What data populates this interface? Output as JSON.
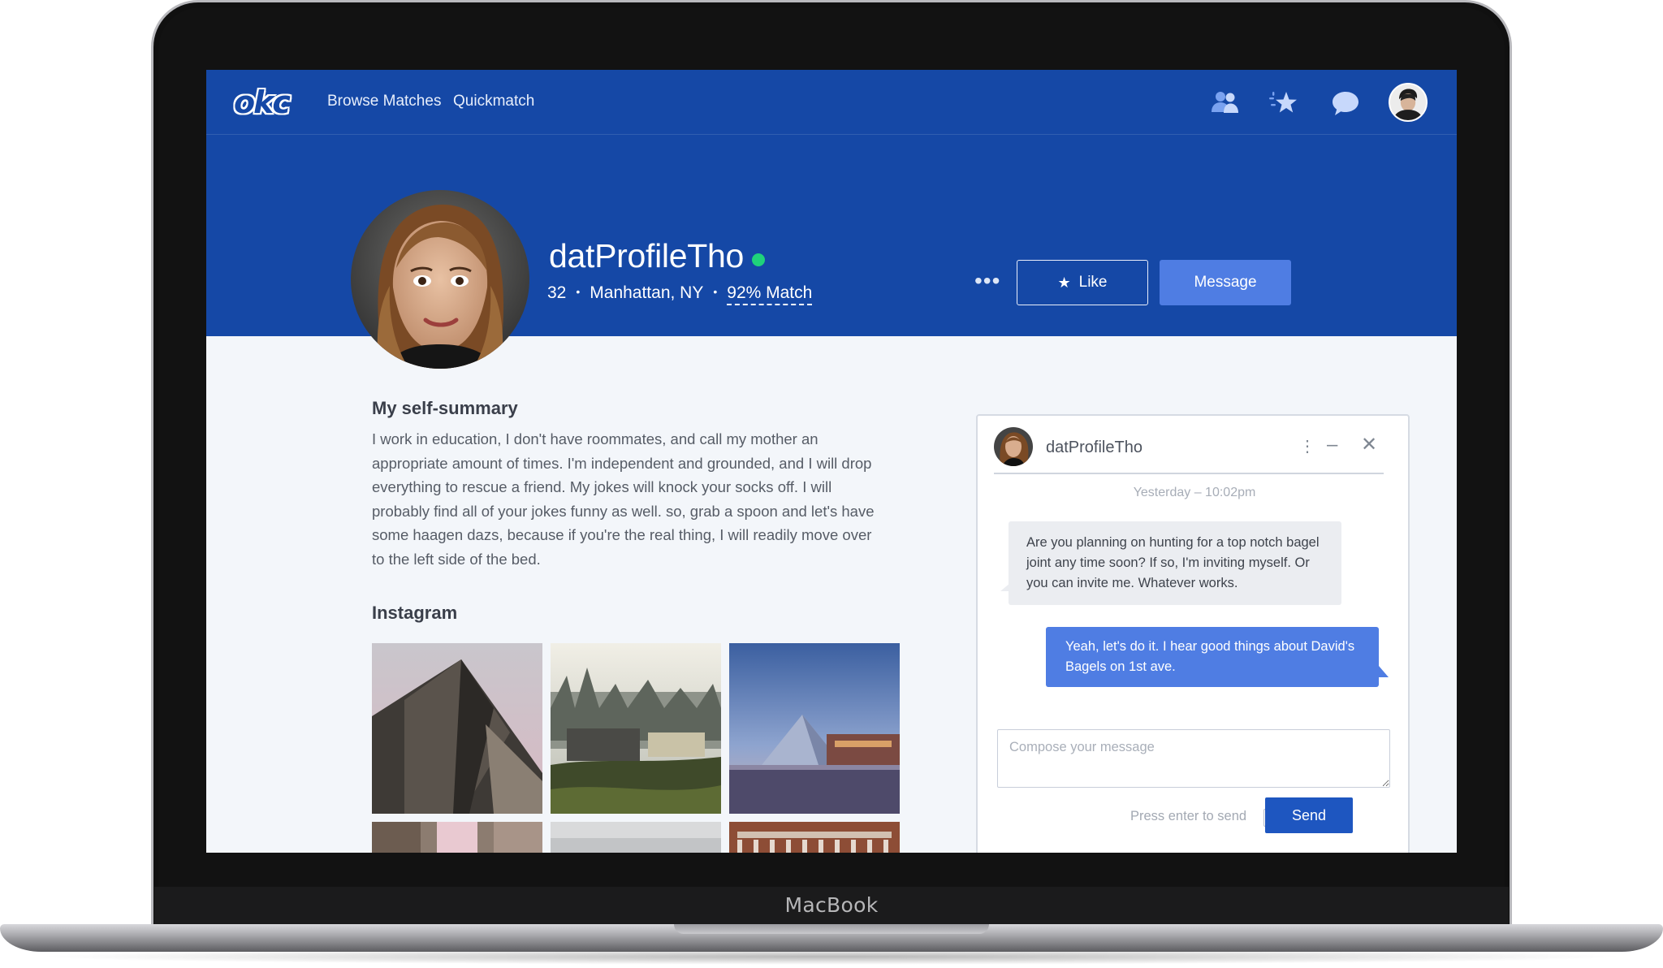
{
  "device": {
    "brand": "MacBook"
  },
  "nav": {
    "logo": "okc",
    "links": [
      "Browse Matches",
      "Quickmatch"
    ],
    "icons": [
      "people-icon",
      "stars-icon",
      "chat-bubble-icon"
    ],
    "colors": {
      "primary": "#1548a6",
      "accent": "#4f7de3",
      "online": "#1fd27b"
    }
  },
  "profile": {
    "username": "datProfileTho",
    "age": "32",
    "location": "Manhattan, NY",
    "match": "92% Match",
    "like_label": "Like",
    "message_label": "Message",
    "more_label": "•••"
  },
  "summary": {
    "title": "My self-summary",
    "text": "I work in education, I don't have roommates, and call my mother an appropriate amount of times. I'm independent and grounded, and I will drop everything to rescue a friend. My jokes will knock your socks off. I will probably find all of your jokes funny as well. so, grab a spoon and let's have some haagen dazs, because if you're the real thing, I will readily move over to the left side of the bed."
  },
  "instagram": {
    "title": "Instagram"
  },
  "chat": {
    "name": "datProfileTho",
    "timestamp": "Yesterday – 10:02pm",
    "messages": [
      {
        "from": "them",
        "text": "Are you planning on hunting for a top notch bagel joint any time soon? If so, I'm inviting myself. Or you can invite me. Whatever works."
      },
      {
        "from": "me",
        "text": "Yeah, let's do it. I hear good things about David's Bagels on 1st ave."
      }
    ],
    "compose_placeholder": "Compose your message",
    "enter_to_send_label": "Press enter to send",
    "send_label": "Send"
  }
}
